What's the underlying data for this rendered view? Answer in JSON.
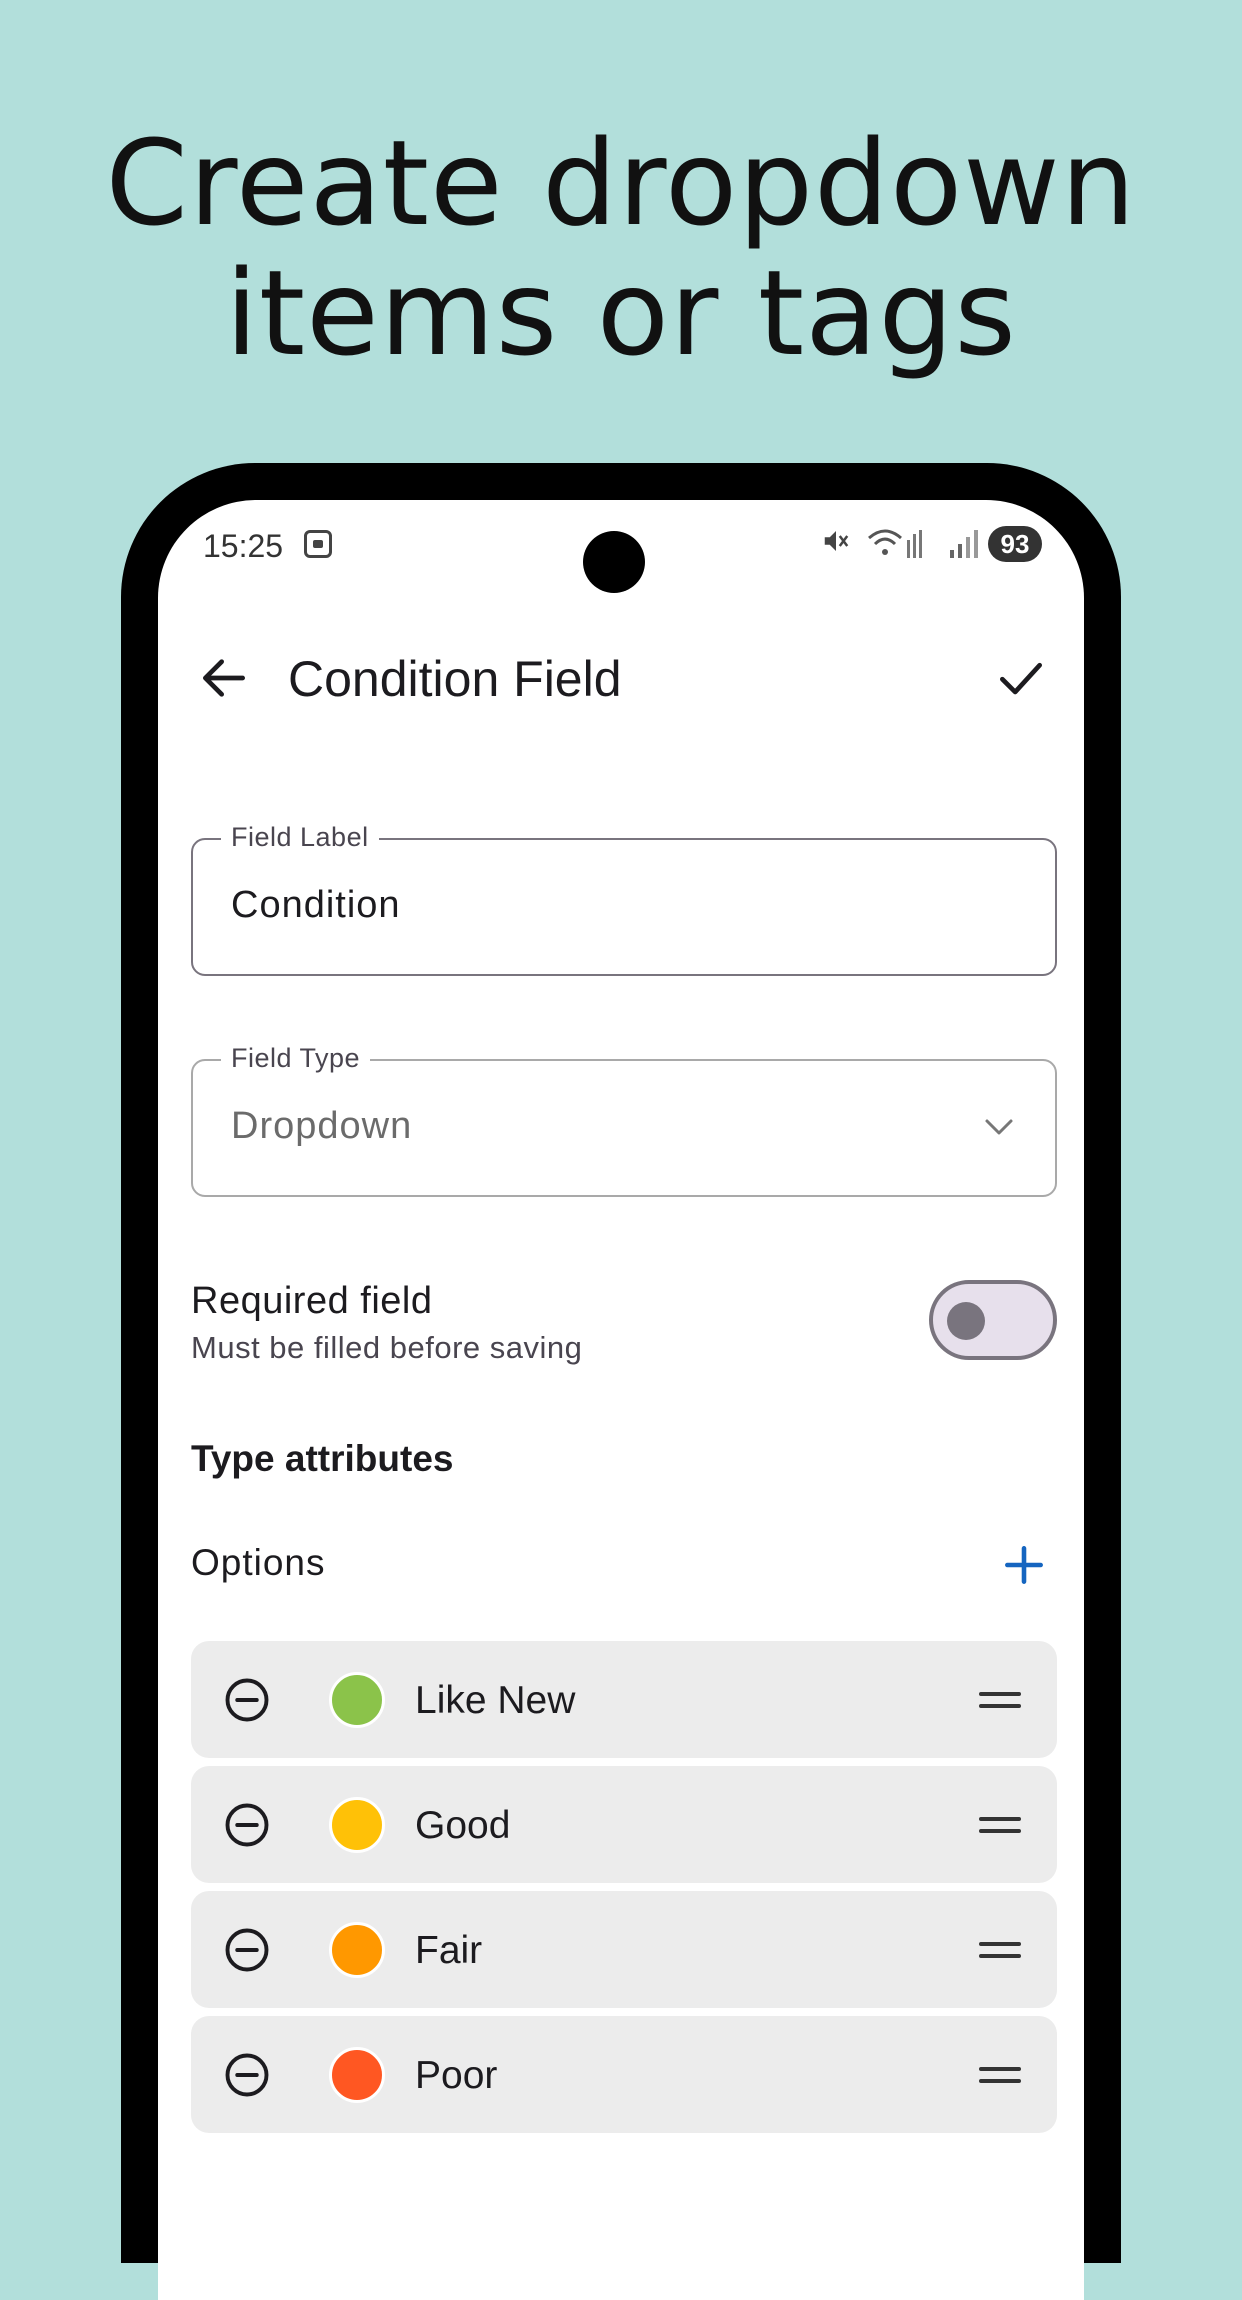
{
  "headline": {
    "line1": "Create dropdown",
    "line2": "items or tags"
  },
  "status_bar": {
    "time": "15:25",
    "battery": "93"
  },
  "app_bar": {
    "title": "Condition Field"
  },
  "field_label": {
    "legend": "Field Label",
    "value": "Condition"
  },
  "field_type": {
    "legend": "Field Type",
    "value": "Dropdown"
  },
  "required": {
    "title": "Required field",
    "subtitle": "Must be filled before saving",
    "enabled": false
  },
  "type_attributes": {
    "title": "Type attributes"
  },
  "options": {
    "label": "Options",
    "items": [
      {
        "label": "Like New",
        "color": "#8bc34a"
      },
      {
        "label": "Good",
        "color": "#ffc107"
      },
      {
        "label": "Fair",
        "color": "#ff9800"
      },
      {
        "label": "Poor",
        "color": "#ff5722"
      }
    ]
  },
  "colors": {
    "background": "#b2dfdb",
    "accent": "#1565c0"
  }
}
